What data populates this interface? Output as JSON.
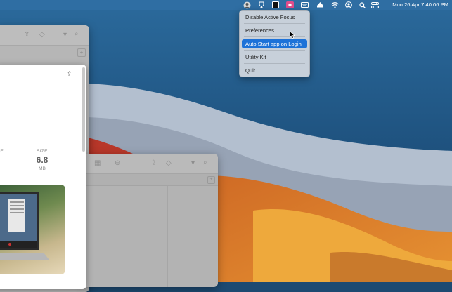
{
  "menubar": {
    "clock": "Mon 26 Apr  7:40:06 PM",
    "bg_color": "#2f6ea3",
    "status_icons": [
      "app-avatar-icon",
      "trophy-icon",
      "terminal-icon",
      "screen-recorder-icon",
      "keyboard-icon",
      "eject-icon",
      "wifi-icon",
      "user-icon",
      "search-icon",
      "control-center-icon"
    ]
  },
  "dropdown": {
    "items": [
      {
        "label": "Disable Active Focus",
        "selected": false
      },
      {
        "label": "Preferences...",
        "selected": false
      },
      {
        "label": "Auto Start app on Login",
        "selected": true
      },
      {
        "label": "Utility Kit",
        "selected": false
      },
      {
        "label": "Quit",
        "selected": false
      }
    ],
    "highlight_color": "#1d72d8"
  },
  "panel": {
    "left_label_fragment": "SE",
    "size_label": "SIZE",
    "size_value": "6.8",
    "size_unit": "MB"
  },
  "wallpaper": {
    "colors": {
      "sky": "#1d4a72",
      "red": "#c0392b",
      "orange": "#e08a2e",
      "yellow": "#f0b43a",
      "light": "#b9c6d6"
    }
  }
}
